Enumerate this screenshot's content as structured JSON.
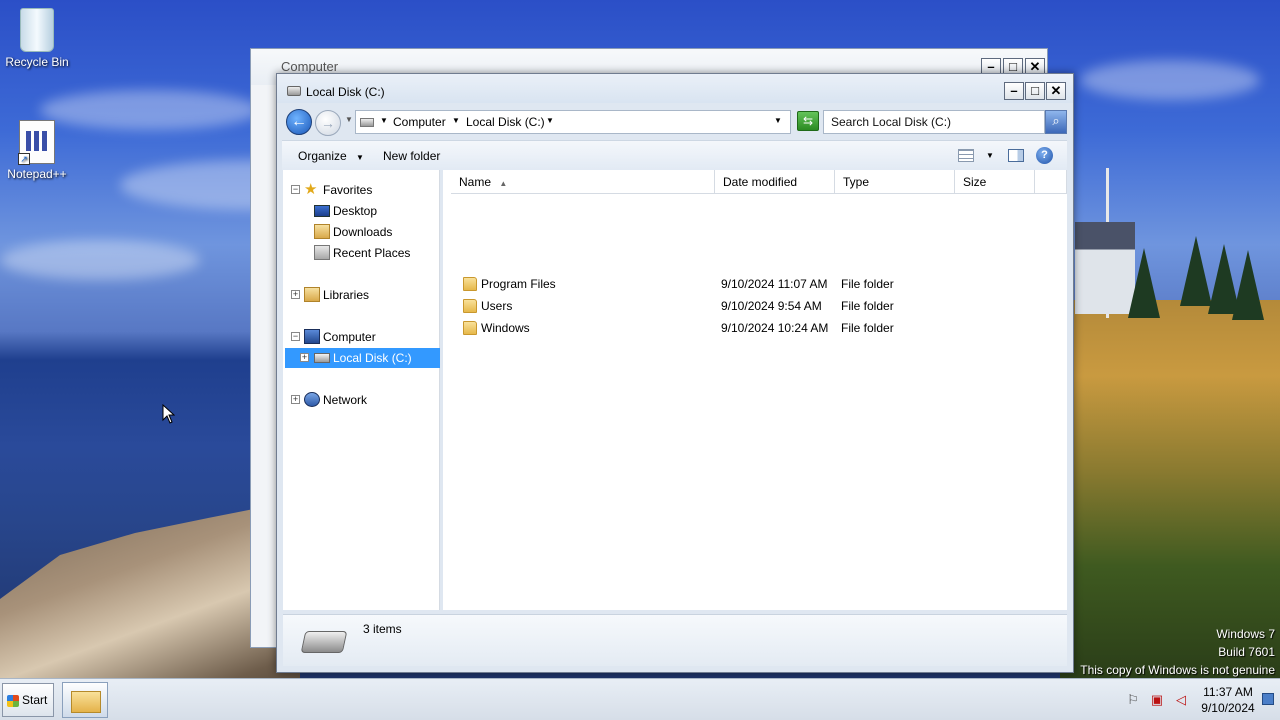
{
  "desktop": {
    "icons": [
      {
        "label": "Recycle Bin",
        "icon": "recycle-bin-icon"
      },
      {
        "label": "Notepad++",
        "icon": "notepad-plus-plus-icon"
      }
    ],
    "watermark": {
      "line1": "Windows 7",
      "line2": "Build 7601",
      "line3": "This copy of Windows is not genuine"
    }
  },
  "back_window": {
    "title": "Computer"
  },
  "window": {
    "title": "Local Disk (C:)",
    "address": {
      "crumbs": [
        "Computer",
        "Local Disk (C:)"
      ]
    },
    "search": {
      "placeholder": "Search Local Disk (C:)"
    },
    "toolbar": {
      "organize": "Organize",
      "new_folder": "New folder"
    },
    "nav_pane": {
      "favorites": "Favorites",
      "desktop": "Desktop",
      "downloads": "Downloads",
      "recent_places": "Recent Places",
      "libraries": "Libraries",
      "computer": "Computer",
      "local_disk": "Local Disk (C:)",
      "network": "Network"
    },
    "columns": {
      "name": "Name",
      "date_modified": "Date modified",
      "type": "Type",
      "size": "Size"
    },
    "files": [
      {
        "name": "Program Files",
        "date": "9/10/2024 11:07 AM",
        "type": "File folder",
        "size": ""
      },
      {
        "name": "Users",
        "date": "9/10/2024 9:54 AM",
        "type": "File folder",
        "size": ""
      },
      {
        "name": "Windows",
        "date": "9/10/2024 10:24 AM",
        "type": "File folder",
        "size": ""
      }
    ],
    "details": {
      "item_count": "3 items"
    }
  },
  "taskbar": {
    "start_label": "Start",
    "clock_time": "11:37 AM",
    "clock_date": "9/10/2024"
  }
}
